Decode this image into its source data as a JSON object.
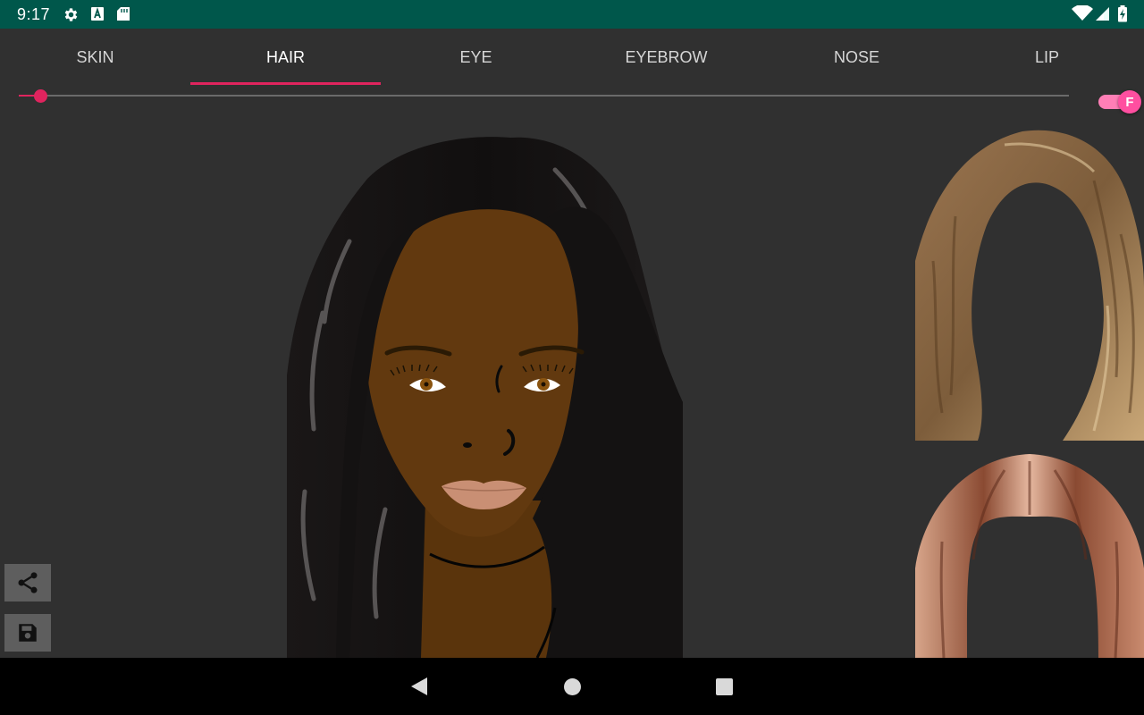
{
  "status_bar": {
    "time": "9:17"
  },
  "tabs": [
    {
      "label": "SKIN",
      "active": false
    },
    {
      "label": "HAIR",
      "active": true
    },
    {
      "label": "EYE",
      "active": false
    },
    {
      "label": "EYEBROW",
      "active": false
    },
    {
      "label": "NOSE",
      "active": false
    },
    {
      "label": "LIP",
      "active": false
    }
  ],
  "slider": {
    "value_fraction": 0.02
  },
  "gender_toggle": {
    "label": "F",
    "on": true
  },
  "colors": {
    "accent": "#e0245e",
    "status_bar": "#00574b",
    "background": "#303030",
    "skin": "#62390f",
    "hair": "#141212",
    "toggle": "#ff4fa0"
  },
  "icons": {
    "status": [
      "gear-icon",
      "a-badge-icon",
      "sd-card-icon",
      "wifi-icon",
      "signal-icon",
      "battery-charging-icon"
    ],
    "actions": [
      "share-icon",
      "save-icon"
    ],
    "nav": [
      "back-icon",
      "home-icon",
      "recents-icon"
    ]
  }
}
